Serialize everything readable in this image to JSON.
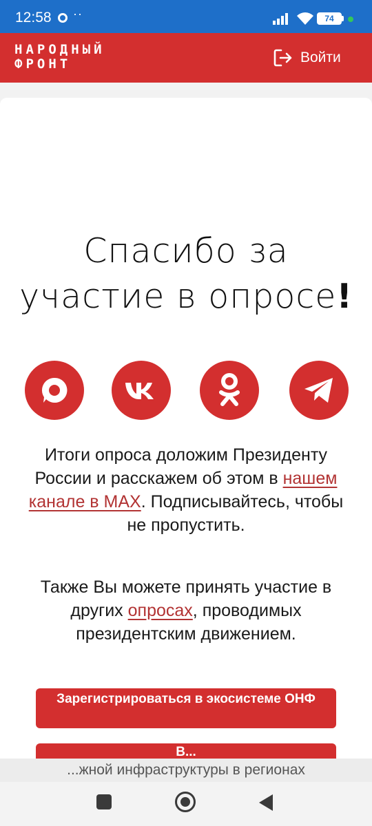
{
  "status_bar": {
    "time": "12:58",
    "dots": "··",
    "battery": "74"
  },
  "header": {
    "logo_line1": "НАРОДНЫЙ",
    "logo_line2": "ФРОНТ",
    "login_label": "Войти"
  },
  "main": {
    "title_line1": "Спасибо за",
    "title_line2": "участие в опросе",
    "title_exclaim": "!",
    "socials": [
      {
        "name": "max",
        "icon": "max-icon"
      },
      {
        "name": "vk",
        "icon": "vk-icon"
      },
      {
        "name": "odnoklassniki",
        "icon": "odnoklassniki-icon"
      },
      {
        "name": "telegram",
        "icon": "telegram-icon"
      }
    ],
    "p1_text_before": "Итоги опроса доложим Президенту России и расскажем об этом в ",
    "p1_link": "нашем канале в MAX",
    "p1_text_after": ". Подписывайтесь, чтобы не пропустить.",
    "p2_text_before": "Также Вы можете принять участие в других ",
    "p2_link": "опросах",
    "p2_text_after": ", проводимых президентским движением.",
    "register_button": "Зарегистрироваться в экосистеме ОНФ",
    "second_button": "В..."
  },
  "tooltip": "...жной инфраструктуры в регионах",
  "colors": {
    "brand_red": "#d32f2f",
    "status_blue": "#1e6fc9",
    "link_red": "#b23333"
  }
}
